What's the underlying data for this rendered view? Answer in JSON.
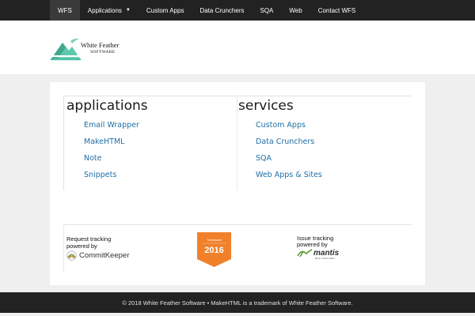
{
  "nav": {
    "items": [
      {
        "label": "WFS"
      },
      {
        "label": "Applications"
      },
      {
        "label": "Custom Apps"
      },
      {
        "label": "Data Crunchers"
      },
      {
        "label": "SQA"
      },
      {
        "label": "Web"
      },
      {
        "label": "Contact WFS"
      }
    ]
  },
  "logo": {
    "line1": "White Feather",
    "line2": "SOFTWARE"
  },
  "applications": {
    "title": "applications",
    "items": [
      "Email Wrapper",
      "MakeHTML",
      "Note",
      "Snippets"
    ]
  },
  "services": {
    "title": "services",
    "items": [
      "Custom Apps",
      "Data Crunchers",
      "SQA",
      "Web Apps & Sites"
    ]
  },
  "badges": {
    "request": {
      "line1": "Request tracking",
      "line2": "powered by",
      "brand": "CommitKeeper"
    },
    "award": {
      "top": "ThreeAward",
      "year": "2016"
    },
    "issue": {
      "line1": "Issue tracking",
      "line2": "powered by",
      "brand": "mantis",
      "sub": "BUG TRACKER"
    }
  },
  "footer": {
    "text": "© 2018 White Feather Software • MakeHTML is a trademark of White Feather Software."
  },
  "colors": {
    "nav_bg": "#222222",
    "link": "#1e6fa5",
    "logo_teal": "#4dbfa5",
    "award_orange": "#f0802a"
  }
}
